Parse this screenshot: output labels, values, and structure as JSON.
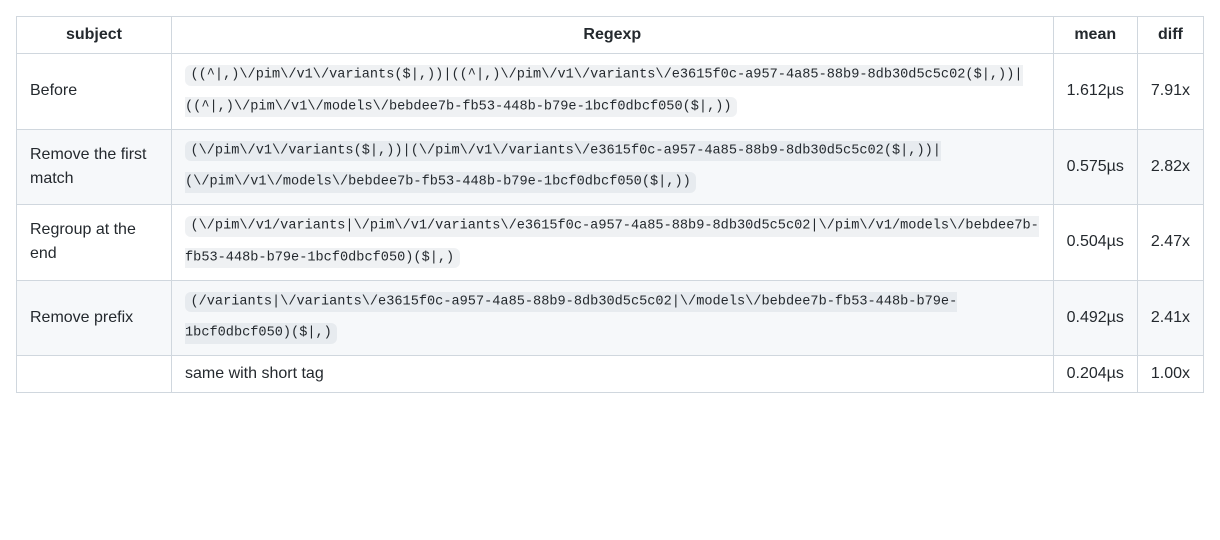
{
  "table": {
    "headers": {
      "subject": "subject",
      "regexp": "Regexp",
      "mean": "mean",
      "diff": "diff"
    },
    "rows": [
      {
        "subject": "Before",
        "regexp": "((^|,)\\/pim\\/v1\\/variants($|,))|((^|,)\\/pim\\/v1\\/variants\\/e3615f0c-a957-4a85-88b9-8db30d5c5c02($|,))|((^|,)\\/pim\\/v1\\/models\\/bebdee7b-fb53-448b-b79e-1bcf0dbcf050($|,))",
        "mean": "1.612µs",
        "diff": "7.91x",
        "is_code": true
      },
      {
        "subject": "Remove the first match",
        "regexp": "(\\/pim\\/v1\\/variants($|,))|(\\/pim\\/v1\\/variants\\/e3615f0c-a957-4a85-88b9-8db30d5c5c02($|,))|(\\/pim\\/v1\\/models\\/bebdee7b-fb53-448b-b79e-1bcf0dbcf050($|,))",
        "mean": "0.575µs",
        "diff": "2.82x",
        "is_code": true
      },
      {
        "subject": "Regroup at the end",
        "regexp": "(\\/pim\\/v1/variants|\\/pim\\/v1/variants\\/e3615f0c-a957-4a85-88b9-8db30d5c5c02|\\/pim\\/v1/models\\/bebdee7b-fb53-448b-b79e-1bcf0dbcf050)($|,)",
        "mean": "0.504µs",
        "diff": "2.47x",
        "is_code": true
      },
      {
        "subject": "Remove prefix",
        "regexp": "(/variants|\\/variants\\/e3615f0c-a957-4a85-88b9-8db30d5c5c02|\\/models\\/bebdee7b-fb53-448b-b79e-1bcf0dbcf050)($|,)",
        "mean": "0.492µs",
        "diff": "2.41x",
        "is_code": true
      },
      {
        "subject": "",
        "regexp": "same with short tag",
        "mean": "0.204µs",
        "diff": "1.00x",
        "is_code": false
      }
    ]
  }
}
